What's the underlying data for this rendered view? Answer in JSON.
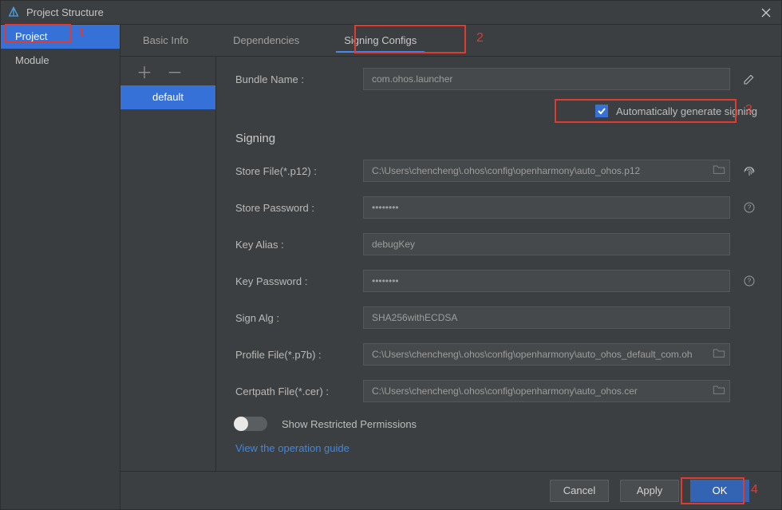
{
  "title": "Project Structure",
  "sidebar": {
    "items": [
      "Project",
      "Module"
    ],
    "selected": 0
  },
  "tabs": {
    "items": [
      "Basic Info",
      "Dependencies",
      "Signing Configs"
    ],
    "active": 2
  },
  "configs": {
    "items": [
      "default"
    ],
    "selected": 0
  },
  "form": {
    "bundle_name_label": "Bundle Name :",
    "bundle_name": "com.ohos.launcher",
    "auto_sign_label": "Automatically generate signing",
    "auto_sign_checked": true,
    "section_signing": "Signing",
    "store_file_label": "Store File(*.p12) :",
    "store_file": "C:\\Users\\chencheng\\.ohos\\config\\openharmony\\auto_ohos.p12",
    "store_password_label": "Store Password :",
    "store_password": "••••••••",
    "key_alias_label": "Key Alias :",
    "key_alias": "debugKey",
    "key_password_label": "Key Password :",
    "key_password": "••••••••",
    "sign_alg_label": "Sign Alg :",
    "sign_alg": "SHA256withECDSA",
    "profile_file_label": "Profile File(*.p7b) :",
    "profile_file": "C:\\Users\\chencheng\\.ohos\\config\\openharmony\\auto_ohos_default_com.oh",
    "certpath_label": "Certpath File(*.cer) :",
    "certpath": "C:\\Users\\chencheng\\.ohos\\config\\openharmony\\auto_ohos.cer",
    "restricted_label": "Show Restricted Permissions",
    "guide_link": "View the operation guide"
  },
  "buttons": {
    "cancel": "Cancel",
    "apply": "Apply",
    "ok": "OK"
  },
  "annotations": {
    "n1": "1",
    "n2": "2",
    "n3": "3",
    "n4": "4"
  }
}
